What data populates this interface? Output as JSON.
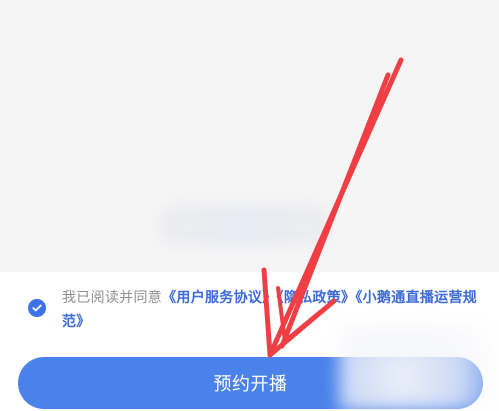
{
  "agreement": {
    "prefix": "我已阅读并同意",
    "links": [
      "《用户服务协议》",
      "《隐私政策》",
      "《小鹅通直播运营规范》"
    ]
  },
  "actions": {
    "primary_label": "预约开播"
  },
  "colors": {
    "brand_blue": "#4b82ea",
    "link_blue": "#3c6ad8",
    "annotation_red": "#ef3f45"
  },
  "icons": {
    "checkbox": "check-circle-icon"
  }
}
